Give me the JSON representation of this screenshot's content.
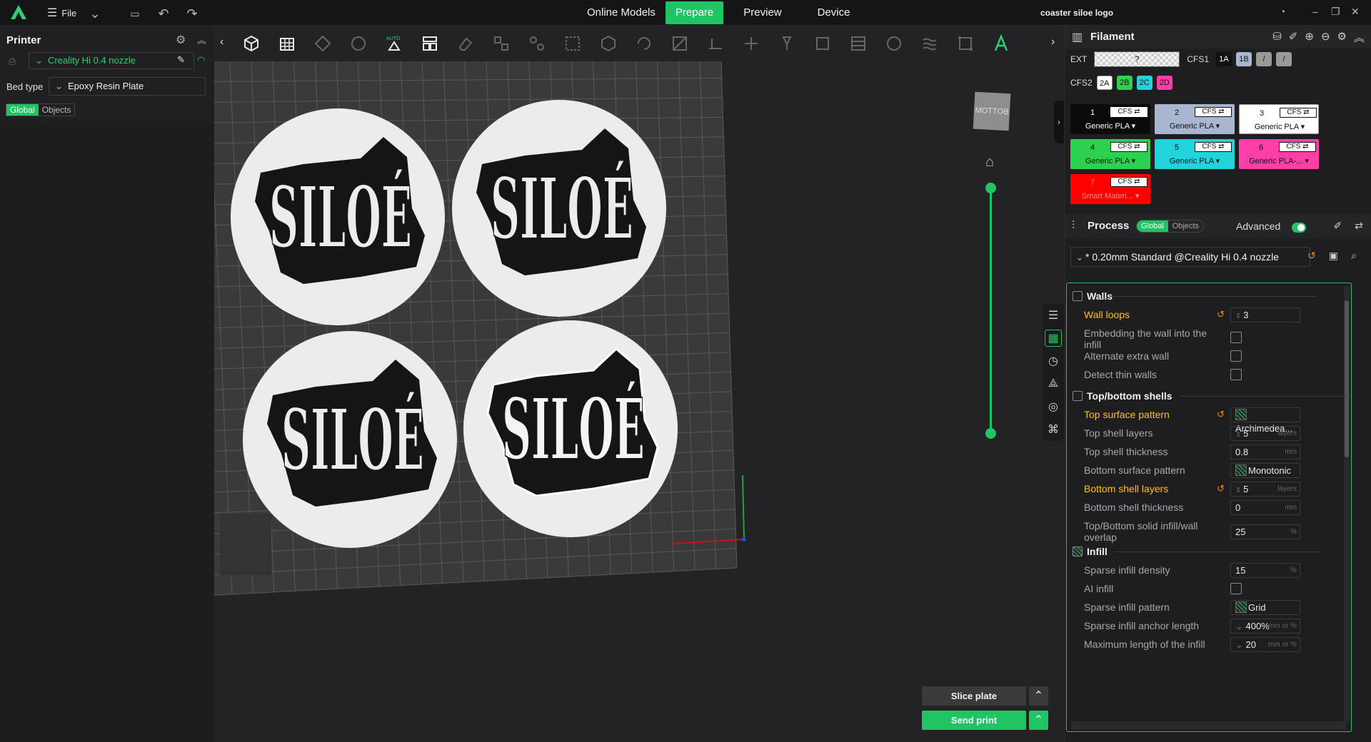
{
  "topbar": {
    "file_label": "File",
    "tabs": [
      "Online Models",
      "Prepare",
      "Preview",
      "Device"
    ],
    "active_tab": "Prepare",
    "project_title": "coaster siloe logo",
    "accent": "#20c464"
  },
  "printer": {
    "title": "Printer",
    "nozzle": "Creality Hi 0.4 nozzle",
    "bed_type_label": "Bed type",
    "bed_type": "Epoxy Resin Plate",
    "scope": [
      "Global",
      "Objects"
    ],
    "scope_active": "Global"
  },
  "viewport": {
    "nav_cube_label": "BOTTOM",
    "slice_button": "Slice plate",
    "send_button": "Send print",
    "coaster_text": [
      "SILOÉ",
      "SILOÉ",
      "SILOÉ",
      "SILOÉ"
    ],
    "layer_slider_range": [
      0,
      1
    ]
  },
  "filament": {
    "title": "Filament",
    "ext_label": "EXT",
    "ext_value": "?",
    "cfs1_label": "CFS1",
    "cfs1_slots": [
      {
        "label": "1A",
        "color": "#111111"
      },
      {
        "label": "1B",
        "color": "#a9b6cf"
      },
      {
        "label": "/",
        "color": "#9a9a9a"
      },
      {
        "label": "/",
        "color": "#9a9a9a"
      }
    ],
    "cfs2_label": "CFS2",
    "cfs2_slots": [
      {
        "label": "2A",
        "color": "#ffffff"
      },
      {
        "label": "2B",
        "color": "#2bd14f"
      },
      {
        "label": "2C",
        "color": "#22d3dc"
      },
      {
        "label": "2D",
        "color": "#ff3ea8"
      }
    ],
    "items": [
      {
        "num": "1",
        "cfs": "CFS ⇄",
        "name": "Generic PLA",
        "color": "#0b0b0b",
        "text": "#ffffff"
      },
      {
        "num": "2",
        "cfs": "CFS ⇄",
        "name": "Generic PLA",
        "color": "#a9b6cf",
        "text": "#111111"
      },
      {
        "num": "3",
        "cfs": "CFS ⇄",
        "name": "Generic PLA",
        "color": "#ffffff",
        "text": "#111111"
      },
      {
        "num": "4",
        "cfs": "CFS ⇄",
        "name": "Generic PLA",
        "color": "#2bd14f",
        "text": "#111111"
      },
      {
        "num": "5",
        "cfs": "CFS ⇄",
        "name": "Generic PLA",
        "color": "#22d3dc",
        "text": "#111111"
      },
      {
        "num": "6",
        "cfs": "CFS ⇄",
        "name": "Generic PLA-...",
        "color": "#ff3ea8",
        "text": "#111111"
      },
      {
        "num": "7",
        "cfs": "CFS ⇄",
        "name": "Smart Materi...",
        "color": "#ff0000",
        "text": "#ff8a8a"
      }
    ]
  },
  "process": {
    "title": "Process",
    "scope": [
      "Global",
      "Objects"
    ],
    "scope_active": "Global",
    "advanced_label": "Advanced",
    "advanced_on": true,
    "preset": "* 0.20mm Standard @Creality Hi 0.4 nozzle"
  },
  "settings": {
    "walls": {
      "title": "Walls",
      "rows": [
        {
          "label": "Wall loops",
          "value": "3",
          "modified": true,
          "type": "spin"
        },
        {
          "label": "Embedding the wall into the infill",
          "modified": false,
          "type": "check"
        },
        {
          "label": "Alternate extra wall",
          "modified": false,
          "type": "check"
        },
        {
          "label": "Detect thin walls",
          "modified": false,
          "type": "check"
        }
      ]
    },
    "shells": {
      "title": "Top/bottom shells",
      "rows": [
        {
          "label": "Top surface pattern",
          "value": "Archimedea...",
          "modified": true,
          "type": "pattern"
        },
        {
          "label": "Top shell layers",
          "value": "5",
          "unit": "layers",
          "modified": false,
          "type": "spin"
        },
        {
          "label": "Top shell thickness",
          "value": "0.8",
          "unit": "mm",
          "modified": false,
          "type": "text"
        },
        {
          "label": "Bottom surface pattern",
          "value": "Monotonic",
          "modified": false,
          "type": "pattern"
        },
        {
          "label": "Bottom shell layers",
          "value": "5",
          "unit": "layers",
          "modified": true,
          "type": "spin"
        },
        {
          "label": "Bottom shell thickness",
          "value": "0",
          "unit": "mm",
          "modified": false,
          "type": "text"
        },
        {
          "label": "Top/Bottom solid infill/wall overlap",
          "value": "25",
          "unit": "%",
          "modified": false,
          "type": "text"
        }
      ]
    },
    "infill": {
      "title": "Infill",
      "rows": [
        {
          "label": "Sparse infill density",
          "value": "15",
          "unit": "%",
          "modified": false,
          "type": "text"
        },
        {
          "label": "AI infill",
          "modified": false,
          "type": "check"
        },
        {
          "label": "Sparse infill pattern",
          "value": "Grid",
          "modified": false,
          "type": "pattern"
        },
        {
          "label": "Sparse infill anchor length",
          "value": "400%",
          "unit": "mm or %",
          "modified": false,
          "type": "select"
        },
        {
          "label": "Maximum length of the infill",
          "value": "20",
          "unit": "mm or %",
          "modified": false,
          "type": "select"
        }
      ]
    }
  }
}
